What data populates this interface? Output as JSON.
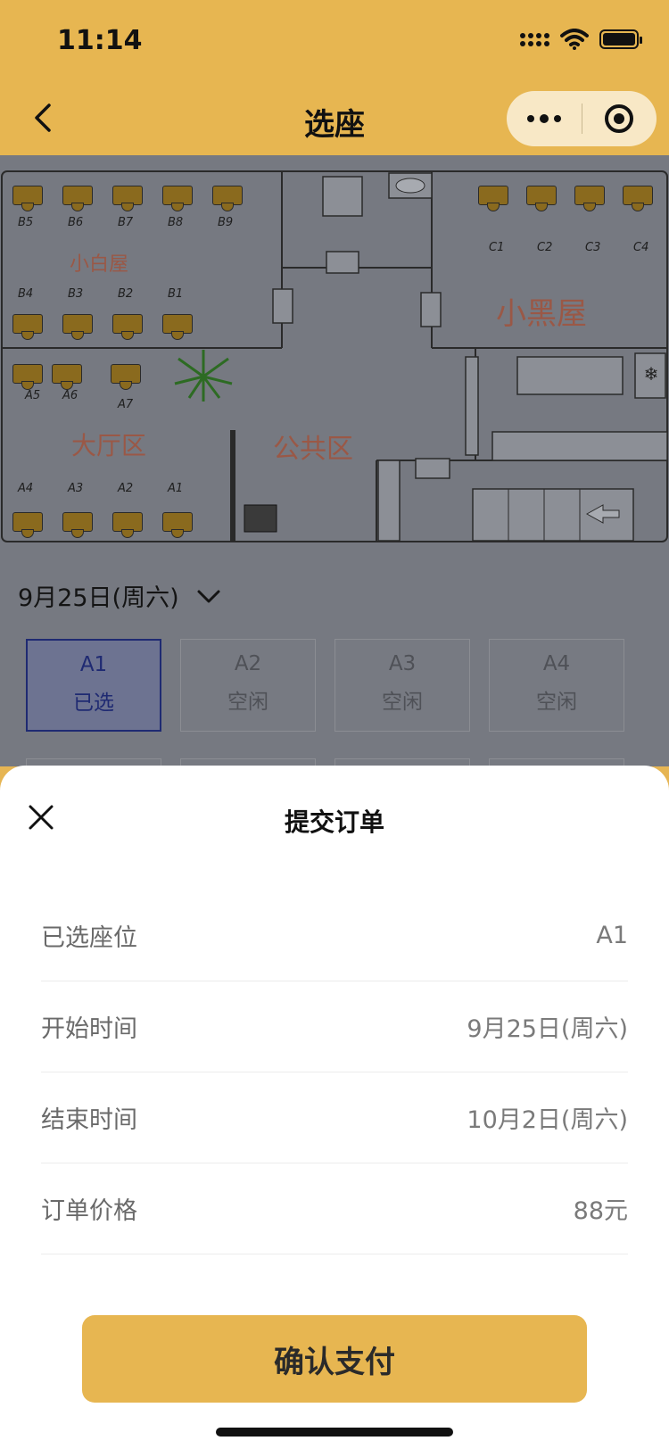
{
  "status_bar": {
    "time": "11:14"
  },
  "nav": {
    "title": "选座"
  },
  "map": {
    "top_row_seats": [
      "B5",
      "B6",
      "B7",
      "B8",
      "B9"
    ],
    "mid_row_seats": [
      "B4",
      "B3",
      "B2",
      "B1"
    ],
    "hall_seats": [
      "A5",
      "A6",
      "A7"
    ],
    "bottom_row_seats": [
      "A4",
      "A3",
      "A2",
      "A1"
    ],
    "right_seats": [
      "C1",
      "C2",
      "C3",
      "C4"
    ],
    "zones": {
      "xiaobaiwu": "小白屋",
      "xiaoheiwu": "小黑屋",
      "datingqu": "大厅区",
      "gonggongqu": "公共区"
    }
  },
  "date_selector": {
    "label": "9月25日(周六)"
  },
  "seat_grid": [
    {
      "code": "A1",
      "state": "已选",
      "selected": true
    },
    {
      "code": "A2",
      "state": "空闲",
      "selected": false
    },
    {
      "code": "A3",
      "state": "空闲",
      "selected": false
    },
    {
      "code": "A4",
      "state": "空闲",
      "selected": false
    }
  ],
  "order_sheet": {
    "title": "提交订单",
    "rows": [
      {
        "label": "已选座位",
        "value": "A1"
      },
      {
        "label": "开始时间",
        "value": "9月25日(周六)"
      },
      {
        "label": "结束时间",
        "value": "10月2日(周六)"
      },
      {
        "label": "订单价格",
        "value": "88元"
      }
    ],
    "confirm_label": "确认支付"
  },
  "colors": {
    "brand": "#e7b651",
    "overlay": "#767981",
    "selected": "#1f2a72"
  }
}
